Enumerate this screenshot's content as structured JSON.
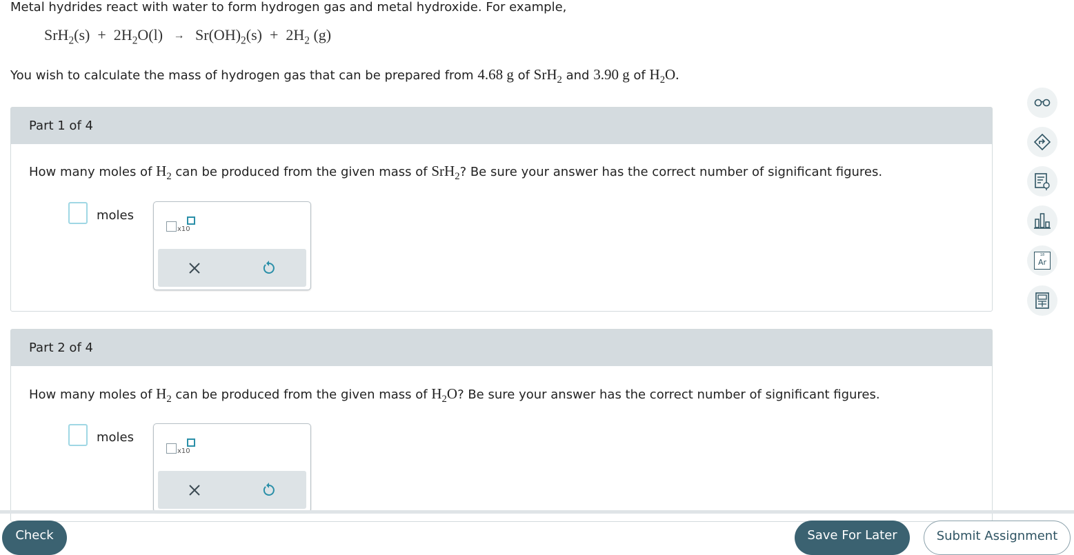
{
  "intro": "Metal hydrides react with water to form hydrogen gas and metal hydroxide. For example,",
  "equation": {
    "reactant1": "SrH",
    "reactant1_sub": "2",
    "reactant1_state": "(s)",
    "plus1": "+",
    "reactant2_coeff": "2H",
    "reactant2_sub": "2",
    "reactant2_rest": "O",
    "reactant2_state": "(l)",
    "arrow": "→",
    "product1": "Sr(OH)",
    "product1_sub": "2",
    "product1_state": "(s)",
    "plus2": "+",
    "product2_coeff": "2",
    "product2": "H",
    "product2_sub": "2",
    "product2_state": "(g)"
  },
  "task": {
    "text_before": "You wish to calculate the mass of hydrogen gas that can be prepared from",
    "mass1": "4.68 g",
    "of1": "of",
    "compound1": "SrH",
    "compound1_sub": "2",
    "and": "and",
    "mass2": "3.90 g",
    "of2": "of",
    "compound2_a": "H",
    "compound2_sub": "2",
    "compound2_b": "O."
  },
  "parts": [
    {
      "header": "Part 1 of 4",
      "q_before": "How many moles of",
      "q_species": "H",
      "q_species_sub": "2",
      "q_middle": "can be produced from the given mass of",
      "q_compound": "SrH",
      "q_compound_sub": "2",
      "q_after": "? Be sure your answer has the correct number of significant figures.",
      "unit": "moles",
      "sci_label": "x10"
    },
    {
      "header": "Part 2 of 4",
      "q_before": "How many moles of",
      "q_species": "H",
      "q_species_sub": "2",
      "q_middle": "can be produced from the given mass of",
      "q_compound_a": "H",
      "q_compound_sub": "2",
      "q_compound_b": "O",
      "q_after": "? Be sure your answer has the correct number of significant figures.",
      "unit": "moles",
      "sci_label": "x10"
    }
  ],
  "toolbar": {
    "icons": [
      "glasses-icon",
      "tag-arrow-icon",
      "notes-icon",
      "bar-chart-icon",
      "periodic-table-icon",
      "calculator-icon"
    ],
    "periodic_element": "Ar",
    "periodic_number": "18"
  },
  "footer": {
    "check": "Check",
    "save": "Save For Later",
    "submit": "Submit Assignment"
  },
  "colors": {
    "header_bg": "#d4dbdf",
    "button_primary": "#3b6271",
    "answer_border": "#9fd7e4",
    "accent_teal": "#2a8fa8"
  }
}
